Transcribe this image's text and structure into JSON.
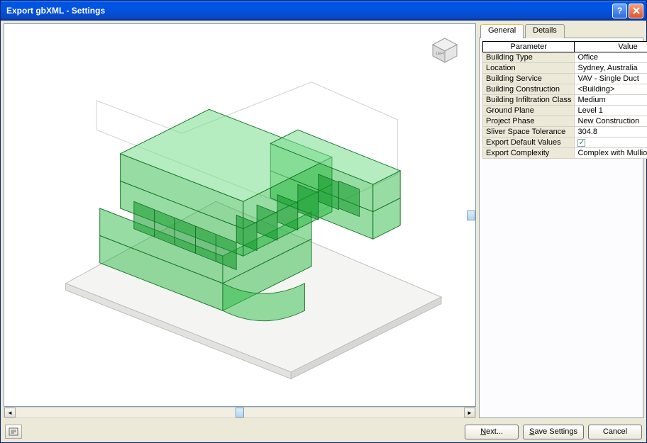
{
  "window": {
    "title": "Export gbXML - Settings"
  },
  "tabs": {
    "general": "General",
    "details": "Details",
    "active": "General"
  },
  "columns": {
    "param": "Parameter",
    "value": "Value"
  },
  "properties": [
    {
      "name": "Building Type",
      "value": "Office"
    },
    {
      "name": "Location",
      "value": "Sydney, Australia"
    },
    {
      "name": "Building Service",
      "value": "VAV - Single Duct"
    },
    {
      "name": "Building Construction",
      "value": "<Building>"
    },
    {
      "name": "Building Infiltration Class",
      "value": "Medium"
    },
    {
      "name": "Ground Plane",
      "value": "Level 1"
    },
    {
      "name": "Project Phase",
      "value": "New Construction"
    },
    {
      "name": "Sliver Space Tolerance",
      "value": "304.8"
    },
    {
      "name": "Export Default Values",
      "value": "[checked]",
      "checkbox": true
    },
    {
      "name": "Export Complexity",
      "value": "Complex with Mullions and S"
    }
  ],
  "buttons": {
    "next": "Next...",
    "save": "Save Settings",
    "cancel": "Cancel"
  }
}
